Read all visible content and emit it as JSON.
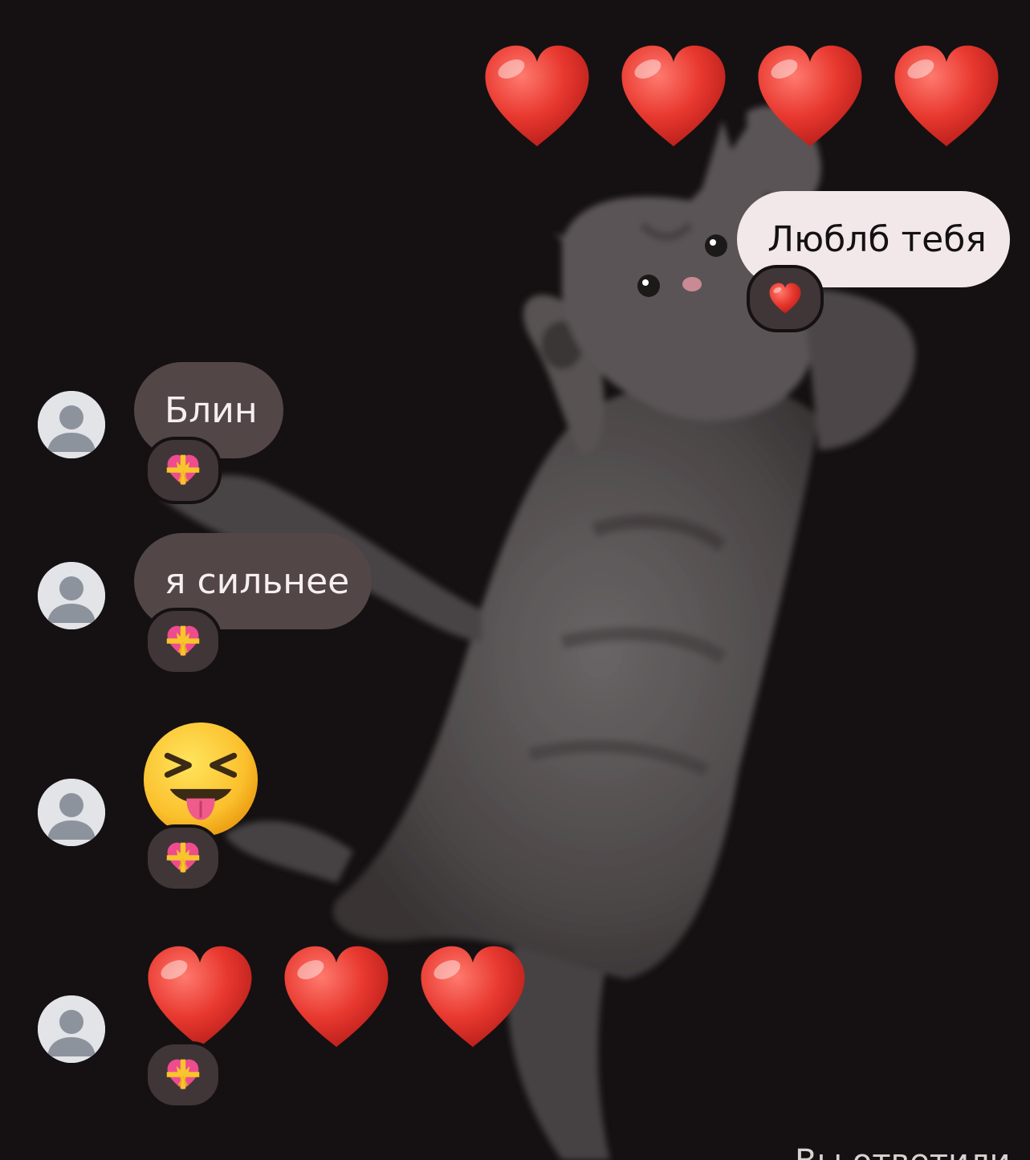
{
  "colors": {
    "background": "#151112",
    "outgoing_bubble": "#f2e8ea",
    "incoming_bubble": "#524647",
    "reaction_chip": "#403637",
    "heart_red": "#e8382f"
  },
  "wallpaper": {
    "icon": "gray-cat-wallpaper"
  },
  "messages": [
    {
      "direction": "outgoing",
      "kind": "emoji",
      "content_icon": "red-heart-icon",
      "count": 4
    },
    {
      "direction": "outgoing",
      "kind": "text",
      "text": "Люблб тебя",
      "reaction_icon": "red-heart-icon"
    },
    {
      "direction": "incoming",
      "kind": "text",
      "text": "Блин",
      "reaction_icon": "heart-with-ribbon-icon",
      "avatar_icon": "default-avatar-icon"
    },
    {
      "direction": "incoming",
      "kind": "text",
      "text": "я сильнее",
      "reaction_icon": "heart-with-ribbon-icon",
      "avatar_icon": "default-avatar-icon"
    },
    {
      "direction": "incoming",
      "kind": "emoji",
      "text": "😝",
      "reaction_icon": "heart-with-ribbon-icon",
      "avatar_icon": "default-avatar-icon"
    },
    {
      "direction": "incoming",
      "kind": "emoji",
      "content_icon": "red-heart-icon",
      "count": 3,
      "reaction_icon": "heart-with-ribbon-icon",
      "avatar_icon": "default-avatar-icon"
    }
  ],
  "footer": {
    "status_text": "Вы ответили"
  }
}
